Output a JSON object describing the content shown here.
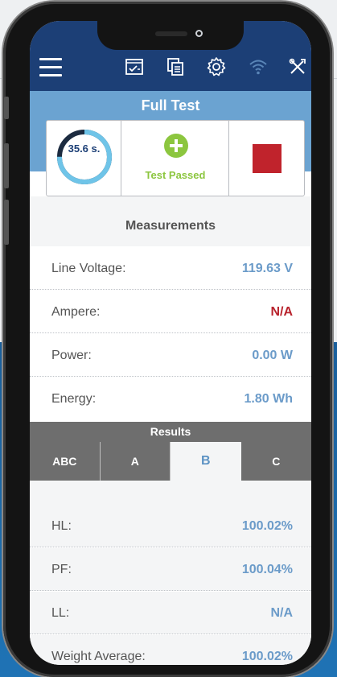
{
  "header": {
    "title": "Full Test"
  },
  "topbar": {
    "icons": [
      "menu-icon",
      "test-icon",
      "copy-icon",
      "settings-icon",
      "wifi-icon",
      "tools-icon"
    ]
  },
  "test": {
    "elapsed": "35.6 s.",
    "progress_fraction": 0.75,
    "status": "Test Passed"
  },
  "measurements": {
    "title": "Measurements",
    "rows": [
      {
        "label": "Line Voltage:",
        "value": "119.63 V"
      },
      {
        "label": "Ampere:",
        "value": "N/A"
      },
      {
        "label": "Power:",
        "value": "0.00 W"
      },
      {
        "label": "Energy:",
        "value": "1.80 Wh"
      }
    ]
  },
  "results": {
    "title": "Results",
    "tabs": [
      "ABC",
      "A",
      "B",
      "C"
    ],
    "active_tab": "B",
    "rows": [
      {
        "label": "HL:",
        "value": "100.02%"
      },
      {
        "label": "PF:",
        "value": "100.04%"
      },
      {
        "label": "LL:",
        "value": "N/A"
      },
      {
        "label": "Weight Average:",
        "value": "100.02%"
      }
    ]
  },
  "colors": {
    "topbar": "#1c3f76",
    "header_band": "#6ba3d1",
    "value_blue": "#6b9bc9",
    "value_red": "#b8232d",
    "pass_green": "#8cc63f",
    "stop_red": "#c0232c"
  }
}
